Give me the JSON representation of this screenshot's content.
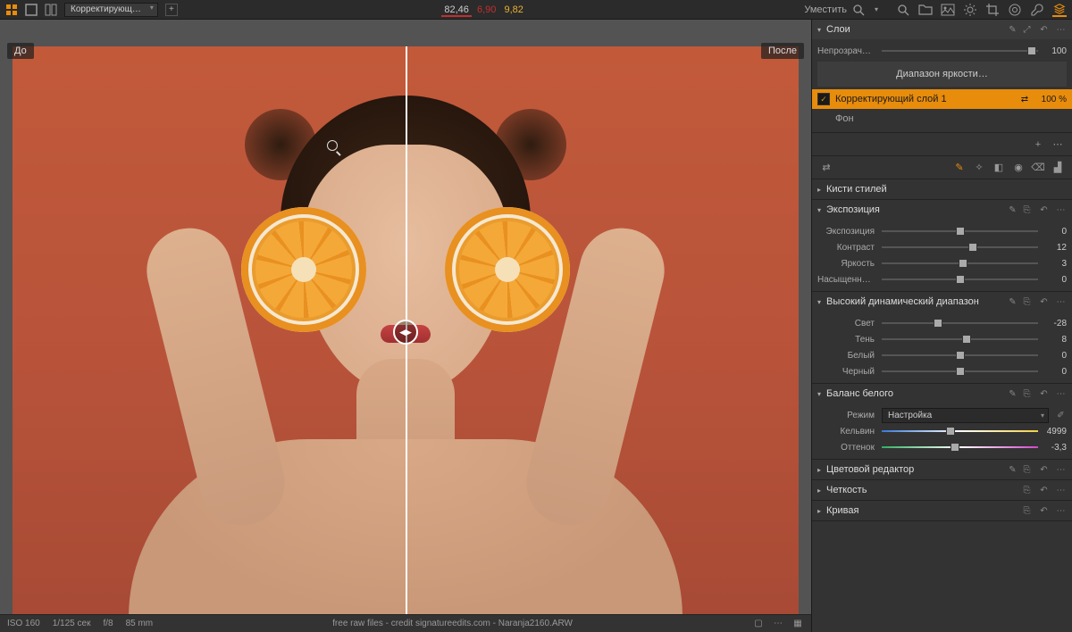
{
  "topbar": {
    "tool_dropdown": "Корректирующ…",
    "stats": {
      "v1": "82,46",
      "v2": "6,90",
      "v3": "9,82"
    },
    "zoom_label": "Уместить"
  },
  "viewer": {
    "before_label": "До",
    "after_label": "После"
  },
  "statusbar": {
    "iso": "ISO 160",
    "shutter": "1/125 сек",
    "aperture": "f/8",
    "focal": "85 mm",
    "filename": "free raw files - credit signatureedits.com - Naranja2160.ARW"
  },
  "panel": {
    "layers_title": "Слои",
    "opacity_label": "Непрозрачно…",
    "opacity_value": "100",
    "lum_range": "Диапазон яркости…",
    "layer_active": "Корректирующий слой 1",
    "layer_active_pct": "100 %",
    "layer_bg": "Фон",
    "style_brush": "Кисти стилей",
    "exposure": "Экспозиция",
    "exp_rows": {
      "exposure": {
        "label": "Экспозиция",
        "value": "0",
        "pos": 50
      },
      "contrast": {
        "label": "Контраст",
        "value": "12",
        "pos": 58
      },
      "brightness": {
        "label": "Яркость",
        "value": "3",
        "pos": 52
      },
      "saturation": {
        "label": "Насыщенно…",
        "value": "0",
        "pos": 50
      }
    },
    "hdr": "Высокий динамический диапазон",
    "hdr_rows": {
      "highlight": {
        "label": "Свет",
        "value": "-28",
        "pos": 36
      },
      "shadow": {
        "label": "Тень",
        "value": "8",
        "pos": 54
      },
      "white": {
        "label": "Белый",
        "value": "0",
        "pos": 50
      },
      "black": {
        "label": "Черный",
        "value": "0",
        "pos": 50
      }
    },
    "wb": "Баланс белого",
    "wb_mode_label": "Режим",
    "wb_mode_value": "Настройка",
    "wb_kelvin": {
      "label": "Кельвин",
      "value": "4999",
      "pos": 44
    },
    "wb_tint": {
      "label": "Оттенок",
      "value": "-3,3",
      "pos": 47
    },
    "color_editor": "Цветовой редактор",
    "clarity": "Четкость",
    "curve": "Кривая"
  }
}
